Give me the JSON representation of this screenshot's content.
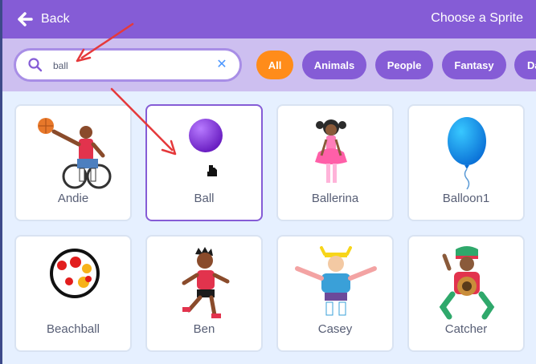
{
  "header": {
    "back_label": "Back",
    "title": "Choose a Sprite"
  },
  "search": {
    "value": "ball"
  },
  "tags": [
    {
      "label": "All",
      "active": true
    },
    {
      "label": "Animals"
    },
    {
      "label": "People"
    },
    {
      "label": "Fantasy"
    },
    {
      "label": "Da"
    }
  ],
  "sprites": [
    {
      "name": "Andie"
    },
    {
      "name": "Ball",
      "selected": true
    },
    {
      "name": "Ballerina"
    },
    {
      "name": "Balloon1"
    },
    {
      "name": "Beachball"
    },
    {
      "name": "Ben"
    },
    {
      "name": "Casey"
    },
    {
      "name": "Catcher"
    }
  ],
  "colors": {
    "header": "#855cd6",
    "filter_bar": "#cdbff0",
    "active_tag": "#ff8c1a",
    "tag": "#855cd6",
    "grid_bg": "#e6f0ff",
    "annotation_arrow": "#e5393b"
  }
}
